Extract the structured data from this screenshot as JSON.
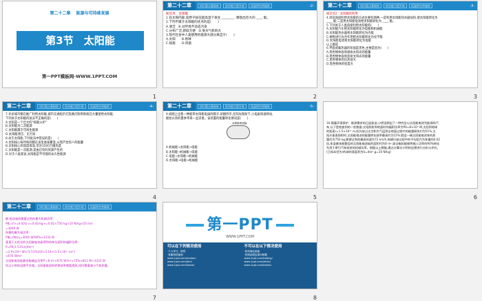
{
  "chapter": "第二十二章",
  "tabs": [
    "知识要点基础练",
    "综合能力提升练",
    "拓展探究突破练"
  ],
  "slide1": {
    "top_left": "第二十二章",
    "top_right": "能源与可持续发展",
    "title": "第3节　太阳能",
    "footer": "第一PPT模板网-WWW.1PPT.COM",
    "num": "1"
  },
  "slide2": {
    "pg": "-2-",
    "num": "2",
    "lines": [
      "知识点　太阳能",
      "1.在太阳内部,氢原子核在超高温下发生 ________ ,释放出巨大的 ____ 能。",
      "2.下列不属于太阳能的优点的是(　　)",
      "A.清洁　B.对环境不造成污染",
      "C.分布广泛,获取方便　D.受天气影响大",
      "3.现代社会中人类使用的能源大部分来自于(　　)",
      "A.太阳　　B.地球",
      "C.核能　　D.风能"
    ]
  },
  "slide3": {
    "pg": "-3-",
    "num": "3",
    "lines": [
      "知识点2　太阳能的利用",
      "4.目前直接利用太阳能的方式主要有两种,一是利用太阳能热水器加热,使太阳能转化为",
      "____ 能;二是用太阳能电池把太阳能转化为 ____ 能。",
      "5.下列关于人类直接利用太阳能的(　　)",
      "A.太阳能汽车把太阳能转化为电能和机械能",
      "B.太阳能热水器将太阳能转化为内能",
      "C.植物进行光合作用把太阳能转化为化学能",
      "D.太阳能电池将太阳能转化为电能",
      "以上都是",
      "6.平面式集热器的背面是黑色,主要是因为(　　)",
      "A.黑色物体容易吸收太阳光的能量",
      "B.黑色物体容易反射太阳光的能量",
      "C.黑色物体的比热容大",
      "D.黑色物体的密度大"
    ]
  },
  "slide4": {
    "pg": "-4-",
    "num": "4",
    "lines": [
      "7.许多城市都在推广利用太阳能,城市交通指示灯及路灯照明系统已大量使用太阳能,",
      "下列关于太阳能的说法不正确的是(　　)",
      "A.太阳是一个巨大的\"核能火炉\"",
      "B.太阳能为二次能源",
      "C.太阳能属于可再生能源",
      "D.太阳能清洁、无污染",
      "8.关于太阳能,下列说法中错误的是(　　)",
      "A.太阳核心每时每刻都在发生氢核聚变,从而产生惊人的能量",
      "B.太阳核心的温度很高,可达1500万摄氏度",
      "C.太阳能是一次能源,是由已有的资源产生的",
      "D.对于人类来说,太阳能是不可能的永久性能源"
    ]
  },
  "slide5": {
    "pg": "-5-",
    "num": "5",
    "lines": [
      "9.如图上出售一种能带太阳能电扇的帽子,如图所示,在阳光照射下,小电扇快速转动,",
      "能给炎热的夏季带来一丝凉意。该装置的能量转化情况是(　　)",
      "A.机械能→太阳能→电能",
      "B.太阳能→机械能→电能",
      "C.电能→太阳能→机械能",
      "D.太阳能→电能→机械能"
    ],
    "figure_label": "太阳能电池板"
  },
  "slide6": {
    "num": "6",
    "lines": [
      "10.随着环境保护、能源需求的日益紧迫,小明设想出了一种完全以太阳能电池为能源的汽",
      "车,以下是他查到的一些数据:太阳照射到地面时的辐射功率为P0=8×10³ W,太阳到地球",
      "的距离r=1.5×10¹¹ m,阳光穿过太空和大气层到达地面过程中的能量损失约为51%,太",
      "阳光垂直照射时,太阳能电池的能量转化效率最高约为15%;假设一辆太阳能电池车的质",
      "量约为750 kg,期望达到的最高时速为72 km/h,车辆行驶过程中的平均阻力为车重的0.02",
      "倍,车身最多能敷设的太阳能电池板的面积约为8 m²,驱动电机能够将输入功率的90%转化",
      "为用于牵引汽车前进的机械功率。根据以上数据,通过计算对小明的设想进行分析与评价。",
      "(已知半径为r的球的表面积为S=4πr²,g=10 N/kg)"
    ]
  },
  "slide7": {
    "num": "7",
    "lines": [
      "解:驱动电机需要达到的最大机械功率:",
      "P机=Fv=0.02G·v=0.02mg·v=0.02×750 kg×10 N/kg×20 m/s",
      "=3000 W",
      "所需的最大电功率:",
      "P电=P机/η=3000 W/90%≈3333 W",
      "垂直于太阳光的太阳能电池板得到的单位面积的辐射功率:",
      "P=P0(1-51%)/(4πr²)",
      "=3.9×10²⁶ W×(1-51%)/[4×3.14×(1.5×10¹¹ m)²]",
      "≈676 W/m²",
      "太阳能电池板最多能输出功率P'=8 m²×676 W/m²×15%≈811 W<3333 W",
      "所以小明的设想不合理。太阳能电池的转换效率需要提高,同时需要减小汽车质量。"
    ]
  },
  "slide8": {
    "num": "8",
    "logo": "第一PPT",
    "url": "WWW.1PPT.COM",
    "left_head": "可以在下列情况使用",
    "right_head": "不可以在以下情况使用",
    "left_lines": [
      "·个人学习、研究",
      "·非盈利性使用",
      "www.1ppt.com/moban/",
      "www.1ppt.com/jieri/",
      "www.1ppt.com/xiazai/"
    ],
    "right_lines": [
      "·任何商业用途",
      "·在网站或应用中转载",
      "www.1ppt.com/beijing/",
      "www.1ppt.com/ziliao/",
      "www.1ppt.com/kejian/"
    ]
  }
}
